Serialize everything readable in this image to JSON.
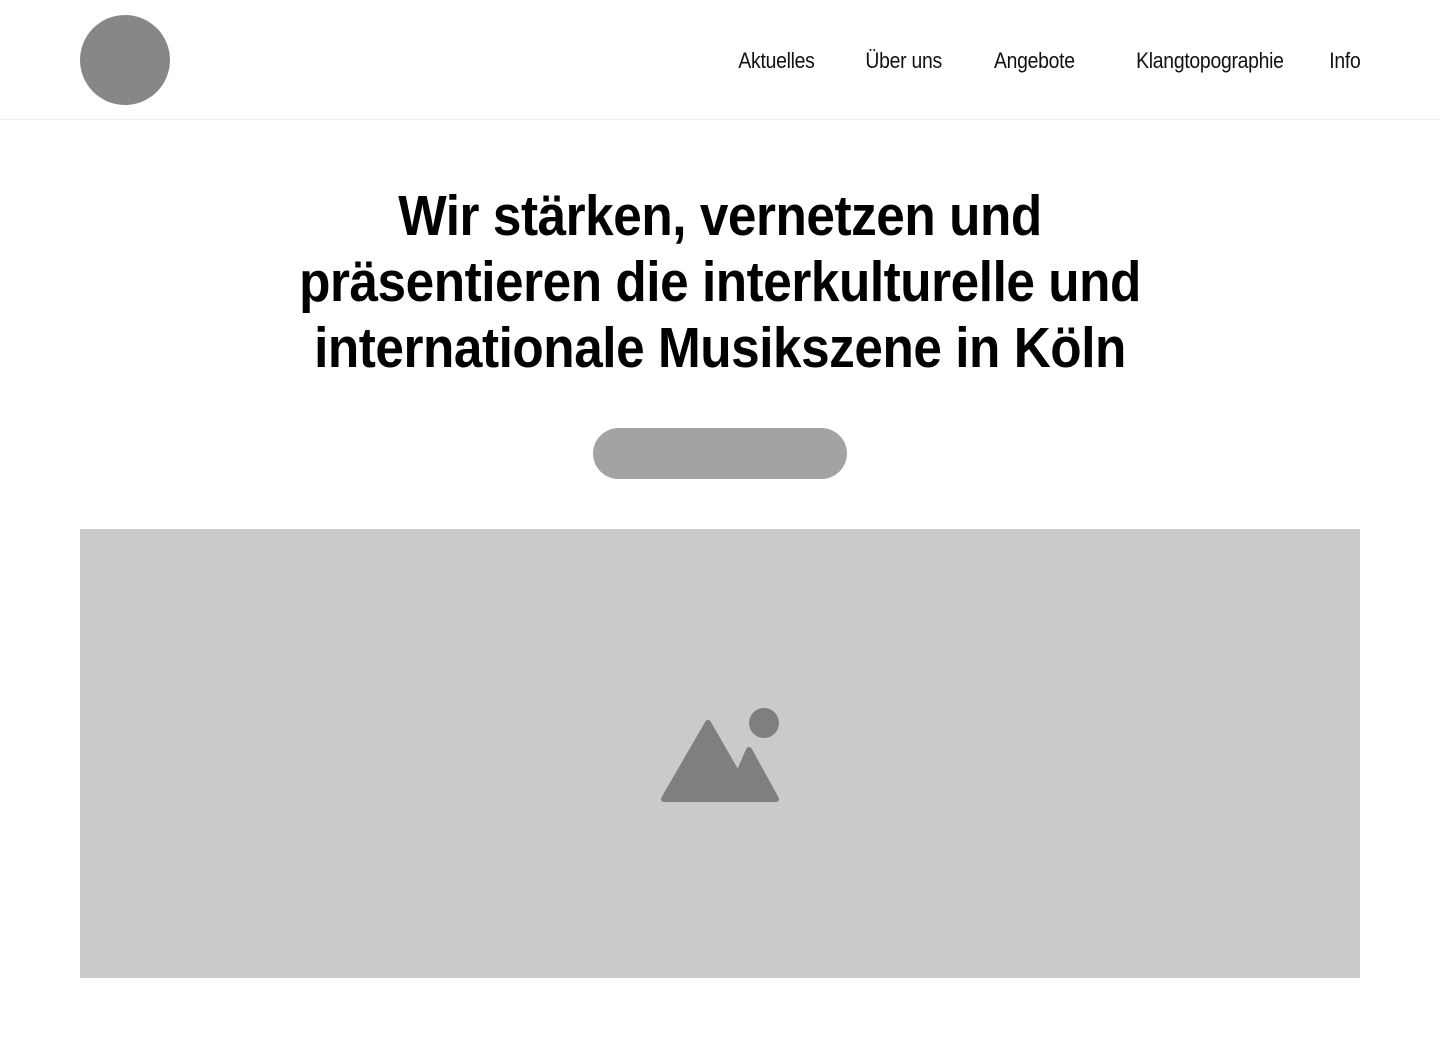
{
  "header": {
    "logo": {
      "shape": "circle",
      "color": "#878787"
    },
    "nav": [
      {
        "label": "Aktuelles"
      },
      {
        "label": "Über uns"
      },
      {
        "label": "Angebote"
      },
      {
        "label": "Klangtopographie"
      },
      {
        "label": "Info"
      }
    ]
  },
  "hero": {
    "title_lines": [
      "Wir stärken, vernetzen und",
      "präsentieren die interkulturelle und",
      "internationale Musikszene in Köln"
    ],
    "cta": {
      "label": "",
      "color": "#a3a3a3"
    },
    "image": {
      "placeholder_icon": "image-placeholder-icon",
      "background": "#cacaca",
      "icon_color": "#7f7f7f"
    }
  }
}
